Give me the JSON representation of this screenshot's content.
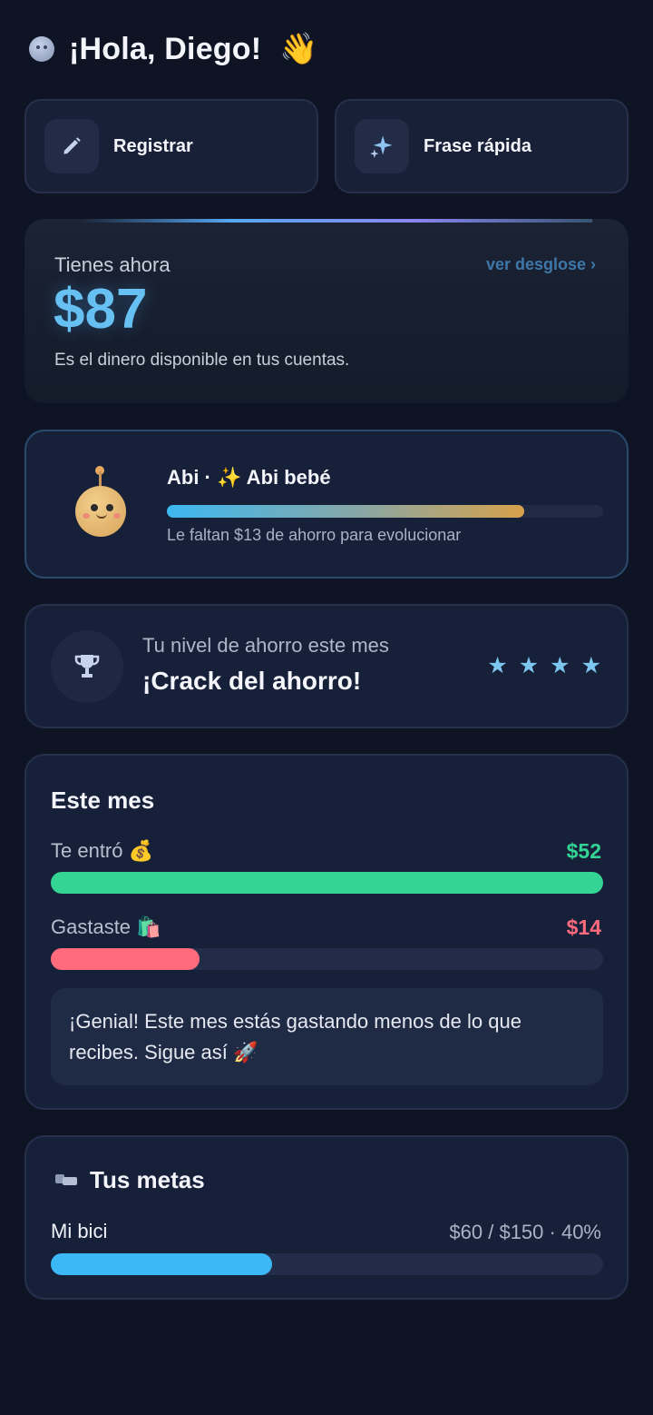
{
  "header": {
    "avatar_icon": "avatar-face-icon",
    "greeting": "¡Hola, Diego!",
    "greeting_emoji": "👋"
  },
  "quick_actions": [
    {
      "label": "Registrar",
      "icon": "pencil-icon"
    },
    {
      "label": "Frase rápida",
      "icon": "sparkle-icon"
    }
  ],
  "balance": {
    "label": "Tienes ahora",
    "link": "ver desglose ›",
    "amount": "$87",
    "subtitle": "Es el dinero disponible en tus cuentas.",
    "accent": "#67c0f2"
  },
  "pet": {
    "title": "Abi · ✨ Abi bebé",
    "progress_fraction": 0.82,
    "subtitle": "Le faltan $13 de ahorro para evolucionar"
  },
  "level": {
    "caption": "Tu nivel de ahorro este mes",
    "title": "¡Crack del ahorro!",
    "stars": 4,
    "star_glyph": "★",
    "icon": "trophy-icon"
  },
  "month": {
    "title": "Este mes",
    "income": {
      "label": "Te entró 💰",
      "value": "$52",
      "fraction": 1.0,
      "color": "#34d495"
    },
    "expense": {
      "label": "Gastaste 🛍️",
      "value": "$14",
      "fraction": 0.27,
      "color": "#ff6b7d"
    },
    "message": "¡Genial! Este mes estás gastando menos de lo que recibes. Sigue así 🚀"
  },
  "goals": {
    "title": "Tus metas",
    "icon": "flag-icon",
    "items": [
      {
        "name": "Mi bici",
        "amount": "$60 / $150 · 40%",
        "fraction": 0.4
      }
    ]
  }
}
